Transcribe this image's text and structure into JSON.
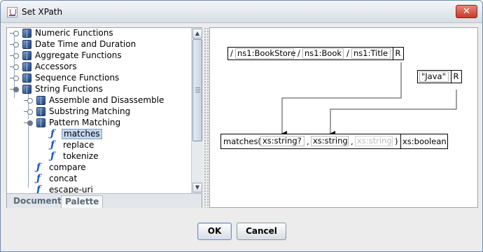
{
  "window": {
    "title": "Set XPath",
    "close_label": "✕"
  },
  "tree": {
    "items": [
      {
        "label": "Numeric Functions",
        "kind": "category"
      },
      {
        "label": "Date Time and Duration",
        "kind": "category"
      },
      {
        "label": "Aggregate Functions",
        "kind": "category"
      },
      {
        "label": "Accessors",
        "kind": "category"
      },
      {
        "label": "Sequence Functions",
        "kind": "category"
      },
      {
        "label": "String Functions",
        "kind": "category-open"
      },
      {
        "label": "Assemble and Disassemble",
        "kind": "subcategory"
      },
      {
        "label": "Substring Matching",
        "kind": "subcategory"
      },
      {
        "label": "Pattern Matching",
        "kind": "subcategory-open"
      },
      {
        "label": "matches",
        "kind": "function",
        "selected": true
      },
      {
        "label": "replace",
        "kind": "function"
      },
      {
        "label": "tokenize",
        "kind": "function"
      },
      {
        "label": "compare",
        "kind": "function"
      },
      {
        "label": "concat",
        "kind": "function"
      },
      {
        "label": "escape-uri",
        "kind": "function"
      }
    ]
  },
  "tabs": [
    {
      "label": "Document",
      "active": false
    },
    {
      "label": "Palette",
      "active": true
    }
  ],
  "canvas": {
    "path": {
      "sep": "/",
      "steps": [
        "ns1:BookStore",
        "ns1:Book",
        "ns1:Title"
      ],
      "r_label": "R"
    },
    "literal": {
      "value": "\"Java\"",
      "r_label": "R"
    },
    "function": {
      "name": "matches(",
      "params": [
        "xs:string?",
        "xs:string",
        "xs:string"
      ],
      "comma": ",",
      "close": ")",
      "return_type": "xs:boolean"
    }
  },
  "buttons": {
    "ok": "OK",
    "cancel": "Cancel"
  }
}
